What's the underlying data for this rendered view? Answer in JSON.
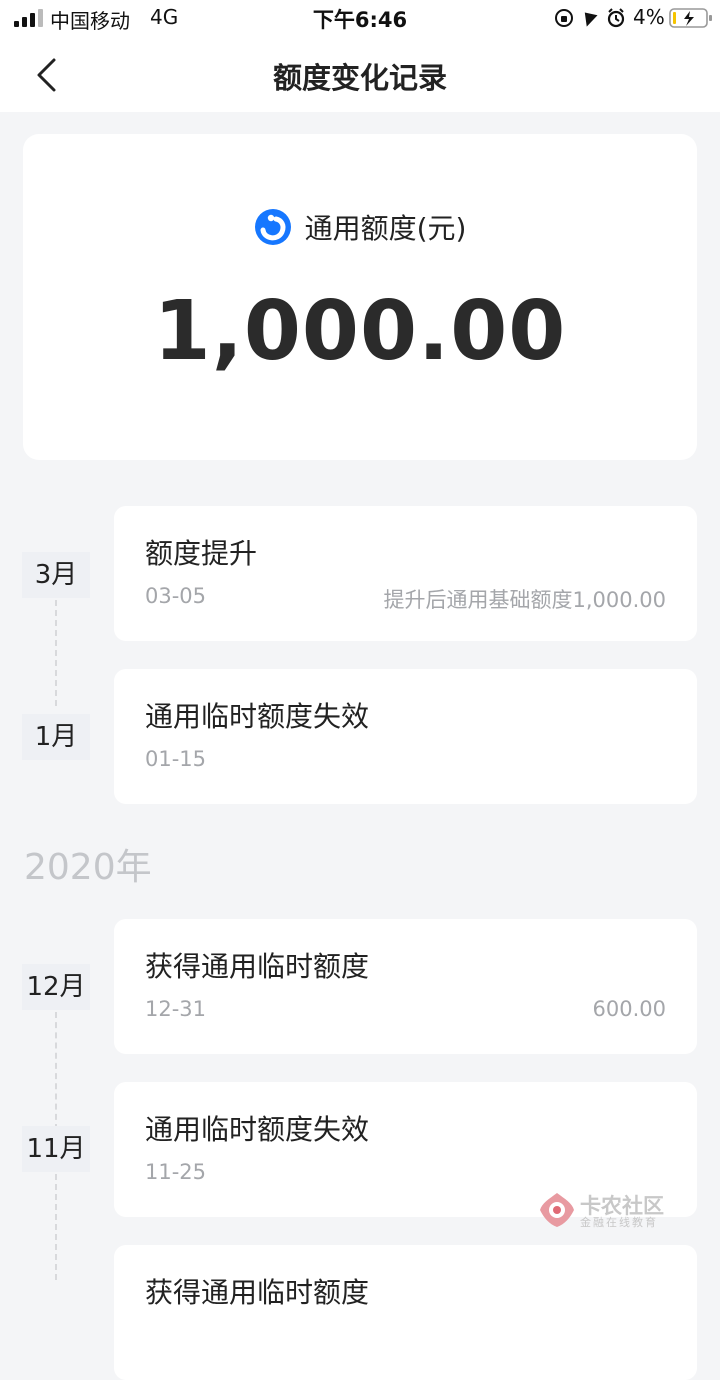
{
  "status_bar": {
    "carrier": "中国移动",
    "network": "4G",
    "time": "下午6:46",
    "battery": "4%"
  },
  "nav": {
    "title": "额度变化记录"
  },
  "limit_card": {
    "label": "通用额度(元)",
    "amount": "1,000.00",
    "brand_color": "#1677ff"
  },
  "records": [
    {
      "month": "3月",
      "title": "额度提升",
      "date": "03-05",
      "desc": "提升后通用基础额度1,000.00"
    },
    {
      "month": "1月",
      "title": "通用临时额度失效",
      "date": "01-15",
      "desc": ""
    },
    {
      "month": "12月",
      "title": "获得通用临时额度",
      "date": "12-31",
      "desc": "600.00"
    },
    {
      "month": "11月",
      "title": "通用临时额度失效",
      "date": "11-25",
      "desc": ""
    },
    {
      "month": "",
      "title": "获得通用临时额度",
      "date": "",
      "desc": ""
    }
  ],
  "year_divider": "2020年",
  "watermark": {
    "title": "卡农社区",
    "subtitle": "金融在线教育"
  }
}
